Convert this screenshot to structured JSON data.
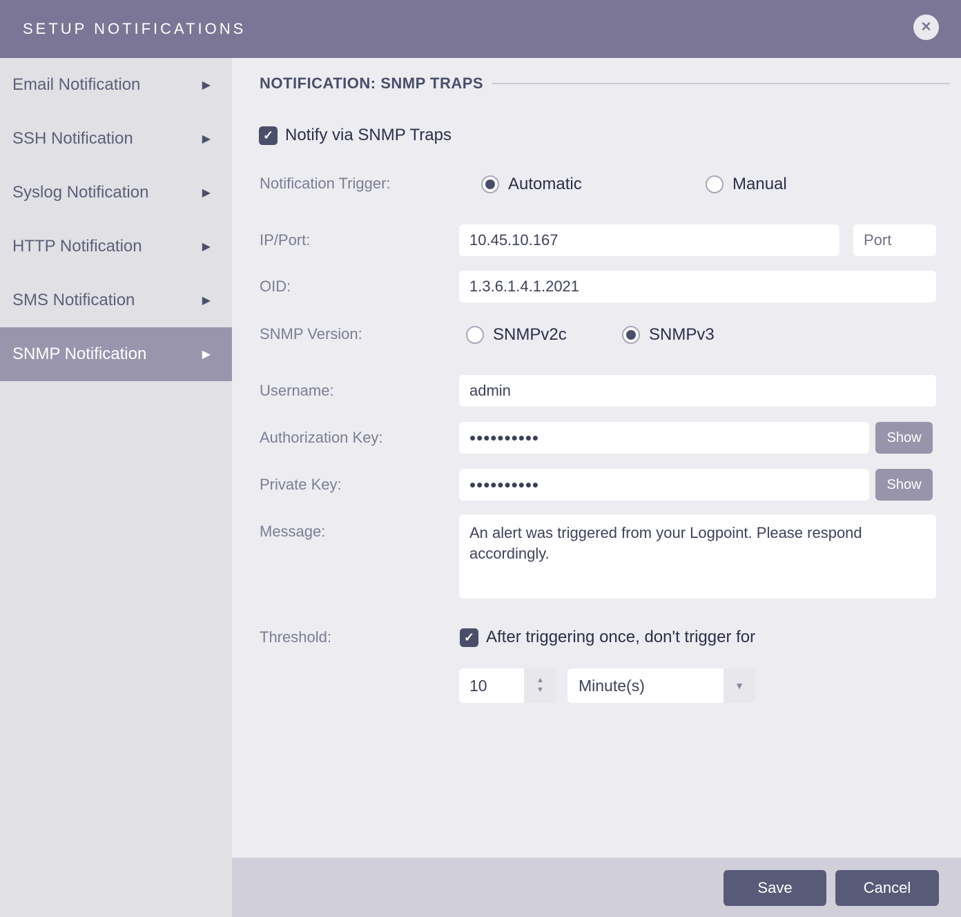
{
  "icons": {
    "close": "✕",
    "arrow_right": "▶",
    "check": "✓",
    "caret_up": "▲",
    "caret_down": "▼"
  },
  "colors": {
    "header_bg": "#7b7695",
    "sidebar_bg": "#e0e0e5",
    "sidebar_selected_bg": "#9995ac",
    "main_bg": "#ececf1",
    "footer_bg": "#d1d0da",
    "button_bg": "#575b78",
    "control_dark": "#4b4e68",
    "show_button_bg": "#9894ab"
  },
  "header": {
    "title": "SETUP NOTIFICATIONS"
  },
  "sidebar": {
    "items": [
      {
        "label": "Email Notification",
        "selected": false
      },
      {
        "label": "SSH Notification",
        "selected": false
      },
      {
        "label": "Syslog Notification",
        "selected": false
      },
      {
        "label": "HTTP Notification",
        "selected": false
      },
      {
        "label": "SMS Notification",
        "selected": false
      },
      {
        "label": "SNMP Notification",
        "selected": true
      }
    ]
  },
  "main": {
    "section_title": "NOTIFICATION: SNMP TRAPS",
    "notify": {
      "label": "Notify via SNMP Traps",
      "checked": true
    },
    "trigger": {
      "label": "Notification Trigger:",
      "automatic_label": "Automatic",
      "manual_label": "Manual",
      "selected": "Automatic"
    },
    "ip_port": {
      "label": "IP/Port:",
      "ip_value": "10.45.10.167",
      "port_placeholder": "Port"
    },
    "oid": {
      "label": "OID:",
      "value": "1.3.6.1.4.1.2021"
    },
    "version": {
      "label": "SNMP Version:",
      "v2c_label": "SNMPv2c",
      "v3_label": "SNMPv3",
      "selected": "SNMPv3"
    },
    "username": {
      "label": "Username:",
      "value": "admin"
    },
    "auth_key": {
      "label": "Authorization Key:",
      "masked_value": "••••••••••",
      "show_label": "Show"
    },
    "private_key": {
      "label": "Private Key:",
      "masked_value": "••••••••••",
      "show_label": "Show"
    },
    "message": {
      "label": "Message:",
      "value": "An alert was triggered from your Logpoint. Please respond accordingly."
    },
    "threshold": {
      "label": "Threshold:",
      "checkbox_label": "After triggering once, don't trigger for",
      "checked": true,
      "amount": "10",
      "unit": "Minute(s)"
    }
  },
  "footer": {
    "save": "Save",
    "cancel": "Cancel"
  }
}
